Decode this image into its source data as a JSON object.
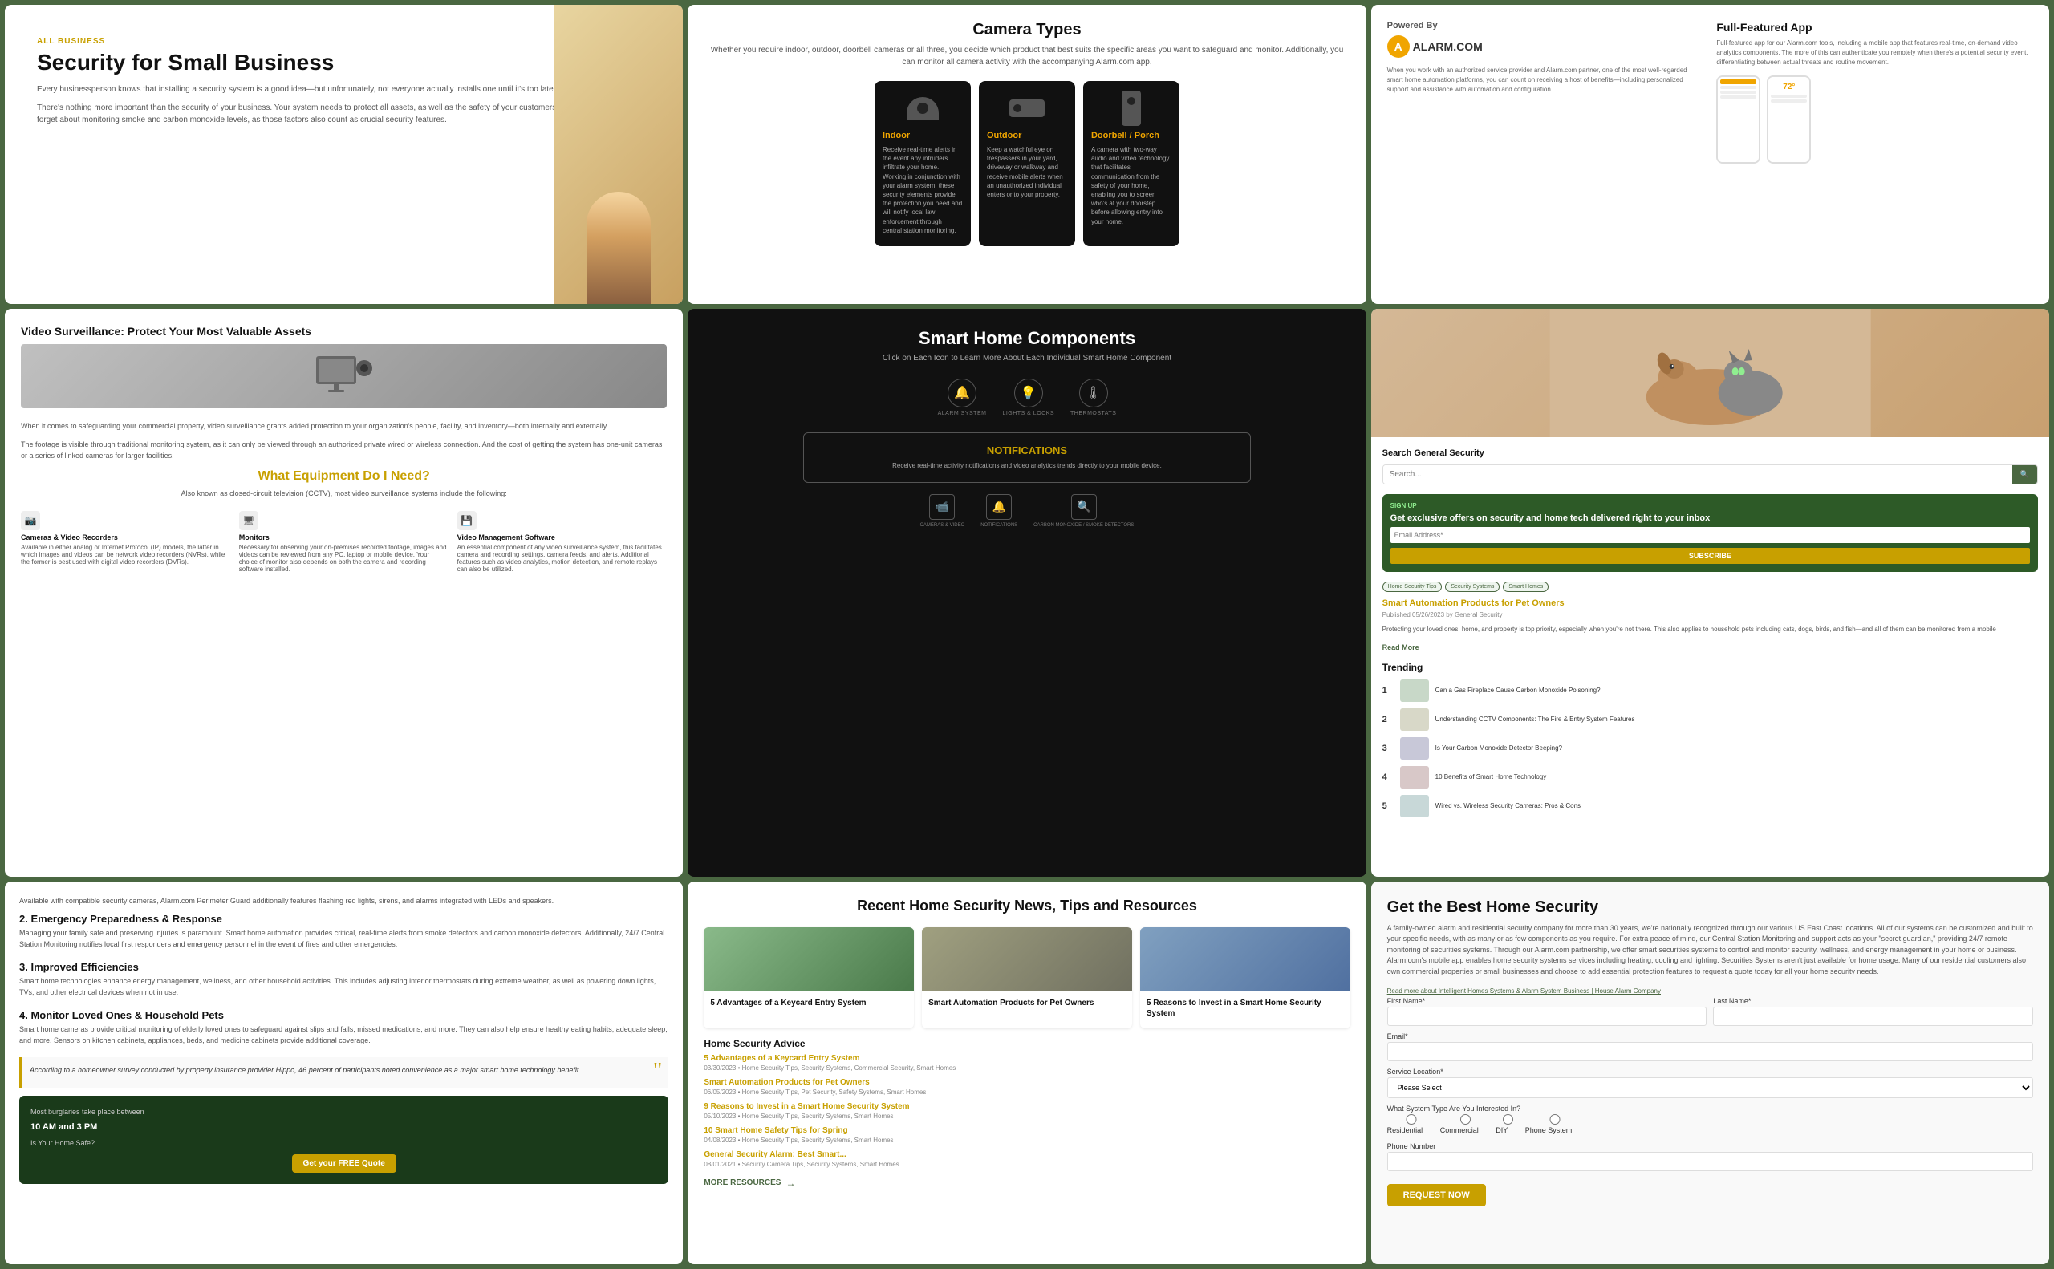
{
  "panels": {
    "top_left": {
      "tag": "ALL BUSINESS",
      "title": "Security for Small Business",
      "body": "Every businessperson knows that installing a security system is a good idea—but unfortunately, not everyone actually installs one until it's too late.",
      "body2": "There's nothing more important than the security of your business. Your system needs to protect all assets, as well as the safety of your customers and employees. Don't forget about monitoring smoke and carbon monoxide levels, as those factors also count as crucial security features."
    },
    "top_center": {
      "title": "Camera Types",
      "subtitle": "Whether you require indoor, outdoor, doorbell cameras or all three, you decide which product that best suits the specific areas you want to safeguard and monitor. Additionally, you can monitor all camera activity with the accompanying Alarm.com app.",
      "cameras": [
        {
          "title": "Indoor",
          "description": "Receive real-time alerts in the event any intruders infiltrate your home. Working in conjunction with your alarm system, these security elements provide the protection you need and will notify local law enforcement through central station monitoring."
        },
        {
          "title": "Outdoor",
          "description": "Keep a watchful eye on trespassers in your yard, driveway or walkway and receive mobile alerts when an unauthorized individual enters onto your property."
        },
        {
          "title": "Doorbell / Porch",
          "description": "A camera with two-way audio and video technology that facilitates communication from the safety of your home, enabling you to screen who's at your doorstep before allowing entry into your home."
        }
      ]
    },
    "top_right": {
      "powered_by_label": "Powered By",
      "alarm_name": "ALARM.COM",
      "alarm_description": "When you work with an authorized service provider and Alarm.com partner, one of the most well-regarded smart home automation platforms, you can count on receiving a host of benefits—including personalized support and assistance with automation and configuration.",
      "full_featured_title": "Full-Featured App",
      "full_featured_desc": "Full-featured app for our Alarm.com tools, including a mobile app that features real-time, on-demand video analytics components. The more of this can authenticate you remotely when there's a potential security event, differentiating between actual threats and routine movement.",
      "temp": "72°"
    },
    "mid_left": {
      "surveillance_title": "Video Surveillance: Protect Your Most Valuable Assets",
      "surveillance_body": "When it comes to safeguarding your commercial property, video surveillance grants added protection to your organization's people, facility, and inventory—both internally and externally.",
      "surveillance_body2": "The footage is visible through traditional monitoring system, as it can only be viewed through an authorized private wired or wireless connection. And the cost of getting the system has one-unit cameras or a series of linked cameras for larger facilities.",
      "equipment_title": "What Equipment Do I Need?",
      "equipment_subtitle": "Also known as closed-circuit television (CCTV), most video surveillance systems include the following:",
      "equipment_items": [
        {
          "name": "Cameras & Video Recorders",
          "desc": "Available in either analog or Internet Protocol (IP) models, the latter in which images and videos can be network video recorders (NVRs), while the former is best used with digital video recorders (DVRs)."
        },
        {
          "name": "Monitors",
          "desc": "Necessary for observing your on-premises recorded footage, images and videos can be reviewed from any PC, laptop or mobile device. Your choice of monitor also depends on both the camera and recording software installed."
        },
        {
          "name": "Video Management Software",
          "desc": "An essential component of any video surveillance system, this facilitates camera and recording settings, camera feeds, and alerts. Additional features such as video analytics, motion detection, and remote replays can also be utilized."
        }
      ]
    },
    "mid_center": {
      "title": "Smart Home Components",
      "subtitle": "Click on Each Icon to Learn More About Each Individual Smart Home Component",
      "icons": [
        {
          "name": "ALARM SYSTEM",
          "symbol": "🔔"
        },
        {
          "name": "LIGHTS & LOCKS",
          "symbol": "💡"
        },
        {
          "name": "THERMOSTATS",
          "symbol": "🌡"
        }
      ],
      "notification_title": "NOTIFICATIONS",
      "notification_desc": "Receive real-time activity notifications and video analytics trends directly to your mobile device.",
      "bottom_icons": [
        {
          "name": "CAMERAS & VIDEO",
          "symbol": "📹"
        },
        {
          "name": "NOTIFICATIONS",
          "symbol": "🔔"
        },
        {
          "name": "CARBON MONOXIDE / SMOKE DETECTORS",
          "symbol": "🔍"
        }
      ]
    },
    "mid_right": {
      "search_label": "Search General Security",
      "search_placeholder": "Search...",
      "search_button": "🔍",
      "signup_tag": "SIGN UP",
      "signup_title": "Get exclusive offers on security and home tech delivered right to your inbox",
      "signup_placeholder": "Email Address*",
      "subscribe_label": "SUBSCRIBE",
      "tags": [
        "Home Security Tips",
        "Security Systems",
        "Smart Homes"
      ],
      "article_title": "Smart Automation Products for Pet Owners",
      "article_date": "Published 05/26/2023 by General Security",
      "article_body": "Protecting your loved ones, home, and property is top priority, especially when you're not there. This also applies to household pets including cats, dogs, birds, and fish—and all of them can be monitored from a mobile",
      "read_more": "Read More",
      "trending_title": "Trending",
      "trending_items": [
        {
          "num": "1",
          "title": "Can a Gas Fireplace Cause Carbon Monoxide Poisoning?"
        },
        {
          "num": "2",
          "title": "Understanding CCTV Components: The Fire & Entry System Features"
        },
        {
          "num": "3",
          "title": "Is Your Carbon Monoxide Detector Beeping?"
        },
        {
          "num": "4",
          "title": "10 Benefits of Smart Home Technology"
        },
        {
          "num": "5",
          "title": "Wired vs. Wireless Security Cameras: Pros & Cons"
        }
      ]
    },
    "bot_left": {
      "intro": "Available with compatible security cameras, Alarm.com Perimeter Guard additionally features flashing red lights, sirens, and alarms integrated with LEDs and speakers.",
      "sections": [
        {
          "num": "2",
          "title": "Emergency Preparedness & Response",
          "body": "Managing your family safe and preserving injuries is paramount. Smart home automation provides critical, real-time alerts from smoke detectors and carbon monoxide detectors. Additionally, 24/7 Central Station Monitoring notifies local first responders and emergency personnel in the event of fires and other emergencies."
        },
        {
          "num": "3",
          "title": "Improved Efficiencies",
          "body": "Smart home technologies enhance energy management, wellness, and other household activities. This includes adjusting interior thermostats during extreme weather, as well as powering down lights, TVs, and other electrical devices when not in use."
        },
        {
          "num": "4",
          "title": "Monitor Loved Ones & Household Pets",
          "body": "Smart home cameras provide critical monitoring of elderly loved ones to safeguard against slips and falls, missed medications, and more. They can also help ensure healthy eating habits, adequate sleep, and more. Sensors on kitchen cabinets, appliances, beds, and medicine cabinets provide additional coverage."
        }
      ],
      "quote_text": "According to a homeowner survey conducted by property insurance provider Hippo, 46 percent of participants noted convenience as a major smart home technology benefit.",
      "burglary_line1": "Most burglaries take place between",
      "burglary_time": "10 AM and 3 PM",
      "burglary_question": "Is Your Home Safe?",
      "get_quote": "Get your FREE Quote"
    },
    "bot_center": {
      "title": "Recent Home Security News, Tips and Resources",
      "news_cards": [
        {
          "title": "5 Advantages of a Keycard Entry System",
          "color": "news-thumb-1"
        },
        {
          "title": "Smart Automation Products for Pet Owners",
          "color": "news-thumb-2"
        },
        {
          "title": "5 Reasons to Invest in a Smart Home Security System",
          "color": "news-thumb-3"
        }
      ],
      "home_advice_title": "Home Security Advice",
      "news_list": [
        {
          "title": "5 Advantages of a Keycard Entry System",
          "meta": "03/30/2023 • Home Security Tips, Security Systems, Commercial Security, Smart Homes"
        },
        {
          "title": "Smart Automation Products for Pet Owners",
          "meta": "06/05/2023 • Home Security Tips, Pet Security, Safety Systems, Smart Homes"
        },
        {
          "title": "9 Reasons to Invest in a Smart Home Security System",
          "meta": "05/10/2023 • Home Security Tips, Security Systems, Smart Homes"
        },
        {
          "title": "10 Smart Home Safety Tips for Spring",
          "meta": "04/08/2023 • Home Security Tips, Security Systems, Smart Homes"
        },
        {
          "title": "General Security Alarm: Best Smart...",
          "meta": "08/01/2021 • Security Camera Tips, Security Systems, Smart Homes"
        }
      ],
      "more_resources": "MORE RESOURCES"
    },
    "bot_right": {
      "title": "Get the Best Home Security",
      "body": "A family-owned alarm and residential security company for more than 30 years, we're nationally recognized through our various US East Coast locations. All of our systems can be customized and built to your specific needs, with as many or as few components as you require. For extra peace of mind, our Central Station Monitoring and support acts as your \"secret guardian,\" providing 24/7 remote monitoring of securities systems. Through our Alarm.com partnership, we offer smart securities systems to control and monitor security, wellness, and energy management in your home or business. Alarm.com's mobile app enables home security systems services including heating, cooling and lighting. Securities Systems aren't just available for home usage. Many of our residential customers also own commercial properties or small businesses and choose to add essential protection features to request a quote today for all your home security needs.",
      "links_label": "Read more about Intelligent Homes Systems & Alarm System Business | House Alarm Company",
      "form": {
        "first_name_label": "First Name*",
        "last_name_label": "Last Name*",
        "email_label": "Email*",
        "service_label": "Service Location*",
        "service_placeholder": "Please Select",
        "system_label": "What System Type Are You Interested In?",
        "system_options": [
          "Residential",
          "Commercial",
          "DIY",
          "Phone System"
        ],
        "phone_label": "Phone Number",
        "request_btn": "REQUEST NOW"
      }
    }
  }
}
